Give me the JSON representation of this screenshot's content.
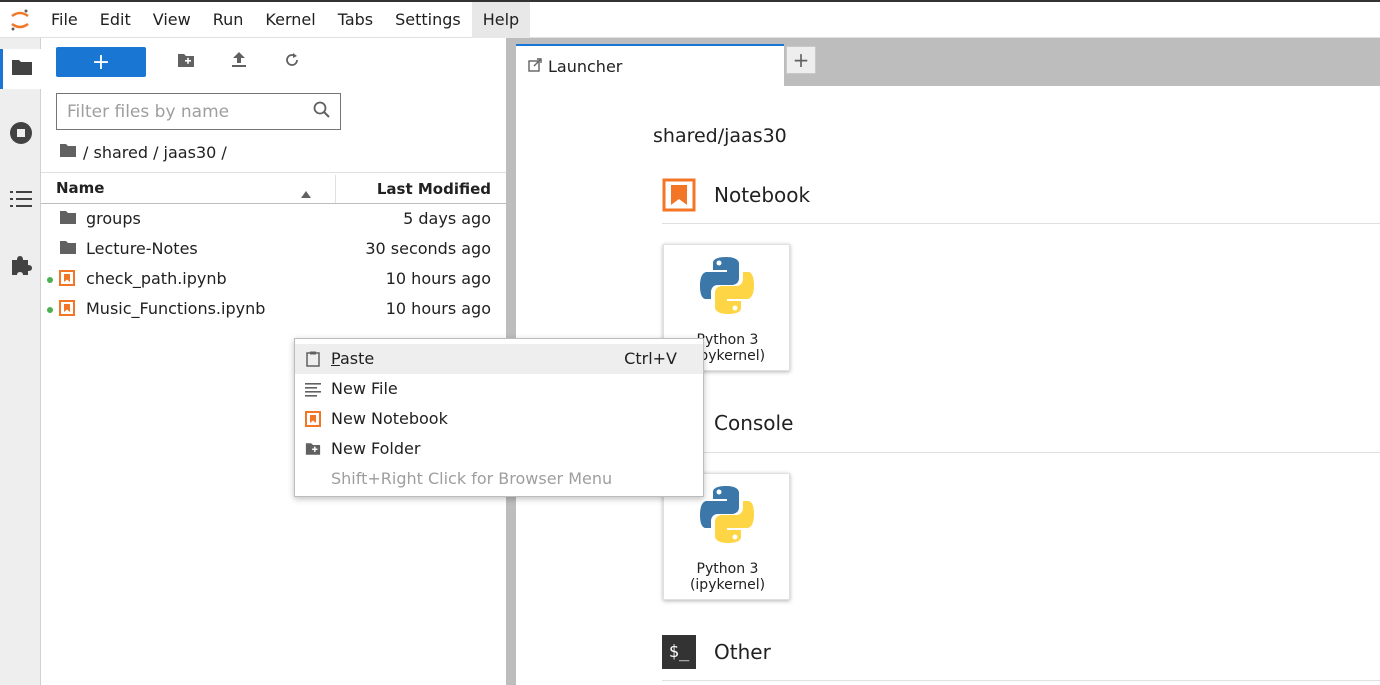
{
  "menubar": {
    "items": [
      "File",
      "Edit",
      "View",
      "Run",
      "Kernel",
      "Tabs",
      "Settings",
      "Help"
    ],
    "active": "Help"
  },
  "activity_bar": {
    "icons": [
      "folder-icon",
      "running-icon",
      "toc-icon",
      "extension-icon"
    ]
  },
  "filebrowser": {
    "new_label": "+",
    "filter_placeholder": "Filter files by name",
    "breadcrumb": "/ shared / jaas30 /",
    "columns": {
      "name": "Name",
      "modified": "Last Modified"
    },
    "files": [
      {
        "name": "groups",
        "modified": "5 days ago",
        "type": "folder",
        "running": false
      },
      {
        "name": "Lecture-Notes",
        "modified": "30 seconds ago",
        "type": "folder",
        "running": false
      },
      {
        "name": "check_path.ipynb",
        "modified": "10 hours ago",
        "type": "notebook",
        "running": true
      },
      {
        "name": "Music_Functions.ipynb",
        "modified": "10 hours ago",
        "type": "notebook",
        "running": true
      }
    ]
  },
  "tabs": [
    {
      "label": "Launcher"
    }
  ],
  "launcher": {
    "path": "shared/jaas30",
    "sections": {
      "notebook": "Notebook",
      "console": "Console",
      "other": "Other"
    },
    "notebook_card": {
      "line1": "Python 3",
      "line2": "(ipykernel)"
    },
    "console_card": {
      "line1": "Python 3",
      "line2": "(ipykernel)"
    },
    "other_icon_text": "$_"
  },
  "context_menu": {
    "items": [
      {
        "label_first": "P",
        "label_rest": "aste",
        "shortcut": "Ctrl+V"
      },
      {
        "label": "New File"
      },
      {
        "label": "New Notebook"
      },
      {
        "label": "New Folder"
      },
      {
        "label": "Shift+Right Click for Browser Menu"
      }
    ]
  },
  "colors": {
    "accent": "#1976d2",
    "notebook_orange": "#f37626",
    "running_dot": "#4caf50"
  }
}
